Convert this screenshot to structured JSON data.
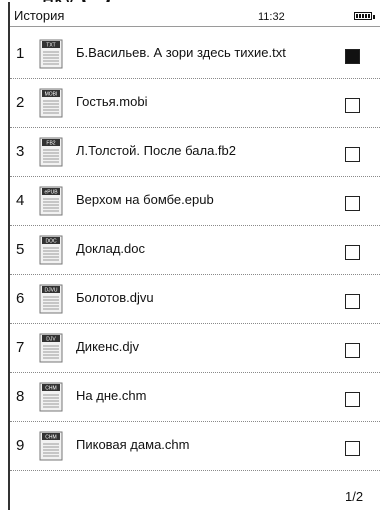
{
  "caption_fragment": "нку",
  "status": {
    "title": "История",
    "time": "11:32",
    "battery_level": 1.0
  },
  "files": [
    {
      "num": "1",
      "name": "Б.Васильев. А зори здесь тихие.txt",
      "format": "TXT",
      "icon": "txt-file-icon",
      "checked": true
    },
    {
      "num": "2",
      "name": "Гостья.mobi",
      "format": "MOBI",
      "icon": "mobi-file-icon",
      "checked": false
    },
    {
      "num": "3",
      "name": "Л.Толстой. После бала.fb2",
      "format": "FB2",
      "icon": "fb2-file-icon",
      "checked": false
    },
    {
      "num": "4",
      "name": "Верхом на бомбе.epub",
      "format": "ePUB",
      "icon": "epub-file-icon",
      "checked": false
    },
    {
      "num": "5",
      "name": "Доклад.doc",
      "format": "DOC",
      "icon": "doc-file-icon",
      "checked": false
    },
    {
      "num": "6",
      "name": "Болотов.djvu",
      "format": "DJVU",
      "icon": "djvu-file-icon",
      "checked": false
    },
    {
      "num": "7",
      "name": "Дикенс.djv",
      "format": "DJV",
      "icon": "djv-file-icon",
      "checked": false
    },
    {
      "num": "8",
      "name": "На дне.chm",
      "format": "CHM",
      "icon": "chm-file-icon",
      "checked": false
    },
    {
      "num": "9",
      "name": "Пиковая дама.chm",
      "format": "CHM",
      "icon": "chm-file-icon",
      "checked": false
    }
  ],
  "pagination": {
    "label": "1/2"
  },
  "colors": {
    "text": "#111111",
    "divider": "#8a8a8a",
    "icon_tag": "#333333"
  }
}
